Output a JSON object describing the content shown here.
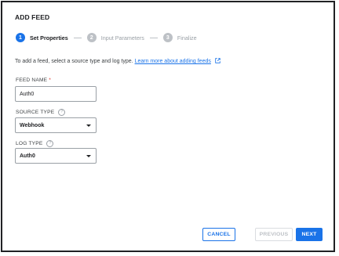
{
  "dialog": {
    "title": "ADD FEED"
  },
  "stepper": {
    "steps": [
      {
        "number": "1",
        "label": "Set Properties",
        "state": "active"
      },
      {
        "number": "2",
        "label": "Input Parameters",
        "state": "inactive"
      },
      {
        "number": "3",
        "label": "Finalize",
        "state": "inactive"
      }
    ]
  },
  "intro": {
    "text": "To add a feed, select a source type and log type.",
    "link_text": "Learn more about adding feeds",
    "link_icon": "external-link-icon"
  },
  "form": {
    "feed_name": {
      "label": "FEED NAME",
      "required_mark": "*",
      "value": "Auth0"
    },
    "source_type": {
      "label": "SOURCE TYPE",
      "help_icon": "?",
      "value": "Webhook"
    },
    "log_type": {
      "label": "LOG TYPE",
      "help_icon": "?",
      "value": "Auth0"
    }
  },
  "footer": {
    "cancel_label": "CANCEL",
    "previous_label": "PREVIOUS",
    "next_label": "NEXT"
  },
  "colors": {
    "accent": "#1a73e8",
    "disabled": "#bdc1c6",
    "required": "#d93025"
  }
}
